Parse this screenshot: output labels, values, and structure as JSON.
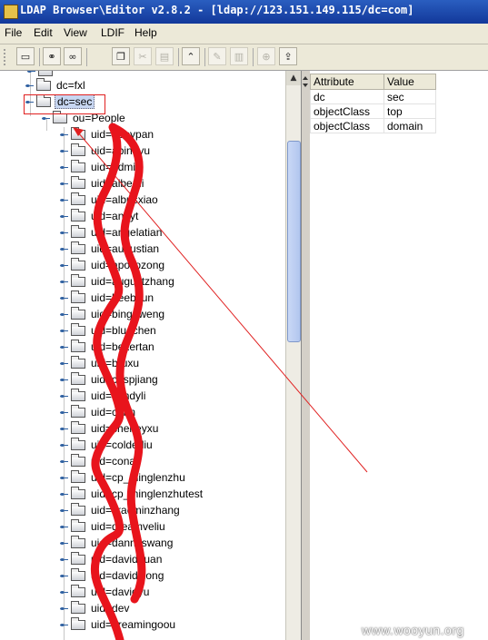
{
  "window": {
    "title": "LDAP Browser\\Editor v2.8.2 - [ldap://123.151.149.115/dc=com]"
  },
  "menu": [
    "File",
    "Edit",
    "View",
    "LDIF",
    "Help"
  ],
  "toolbar": {
    "buttons": [
      {
        "icon": "computer-icon",
        "enabled": true
      },
      {
        "icon": "connect-icon",
        "enabled": true
      },
      {
        "icon": "binoculars-icon",
        "enabled": true
      },
      {
        "icon": "copy-icon",
        "enabled": true
      },
      {
        "icon": "cut-icon",
        "enabled": false
      },
      {
        "icon": "paste-icon",
        "enabled": false
      },
      {
        "icon": "up-icon",
        "enabled": true
      },
      {
        "icon": "edit-icon",
        "enabled": false
      },
      {
        "icon": "delete-icon",
        "enabled": false
      },
      {
        "icon": "add-entry-icon",
        "enabled": false
      },
      {
        "icon": "export-icon",
        "enabled": true
      }
    ]
  },
  "tree": {
    "nodes": [
      {
        "label": "dc=fxl",
        "level": 1
      },
      {
        "label": "dc=sec",
        "level": 1,
        "selected": true
      },
      {
        "label": "ou=People",
        "level": 2
      },
      {
        "label": "uid=abbypan",
        "level": 3
      },
      {
        "label": "uid=abinayu",
        "level": 3
      },
      {
        "label": "uid=admin",
        "level": 3
      },
      {
        "label": "uid=albertli",
        "level": 3
      },
      {
        "label": "uid=albusxiao",
        "level": 3
      },
      {
        "label": "uid=andyt",
        "level": 3
      },
      {
        "label": "uid=angelatian",
        "level": 3
      },
      {
        "label": "uid=augustian",
        "level": 3
      },
      {
        "label": "uid=apollozong",
        "level": 3
      },
      {
        "label": "uid=augustzhang",
        "level": 3
      },
      {
        "label": "uid=beebsun",
        "level": 3
      },
      {
        "label": "uid=bingoweng",
        "level": 3
      },
      {
        "label": "uid=bluechen",
        "level": 3
      },
      {
        "label": "uid=bexertan",
        "level": 3
      },
      {
        "label": "uid=bruxu",
        "level": 3
      },
      {
        "label": "uid=caspjiang",
        "level": 3
      },
      {
        "label": "uid=candyli",
        "level": 3
      },
      {
        "label": "uid=cerin",
        "level": 3
      },
      {
        "label": "uid=cheneyxu",
        "level": 3
      },
      {
        "label": "uid=colderliu",
        "level": 3
      },
      {
        "label": "uid=conali",
        "level": 3
      },
      {
        "label": "uid=cp_minglenzhu",
        "level": 3
      },
      {
        "label": "uid=cp_minglenzhutest",
        "level": 3
      },
      {
        "label": "uid=cracminzhang",
        "level": 3
      },
      {
        "label": "uid=dreamveliu",
        "level": 3
      },
      {
        "label": "uid=dannyswang",
        "level": 3
      },
      {
        "label": "uid=davidduan",
        "level": 3
      },
      {
        "label": "uid=davidxiong",
        "level": 3
      },
      {
        "label": "uid=davidyu",
        "level": 3
      },
      {
        "label": "uid=dev",
        "level": 3
      },
      {
        "label": "uid=dreamingoou",
        "level": 3
      }
    ]
  },
  "attributes": {
    "headers": [
      "Attribute",
      "Value"
    ],
    "rows": [
      [
        "dc",
        "sec"
      ],
      [
        "objectClass",
        "top"
      ],
      [
        "objectClass",
        "domain"
      ]
    ]
  },
  "watermark": "www.wooyun.org",
  "colors": {
    "annotation": "#e02020",
    "scribble": "#e8141c",
    "selection": "#c7d6f1"
  }
}
